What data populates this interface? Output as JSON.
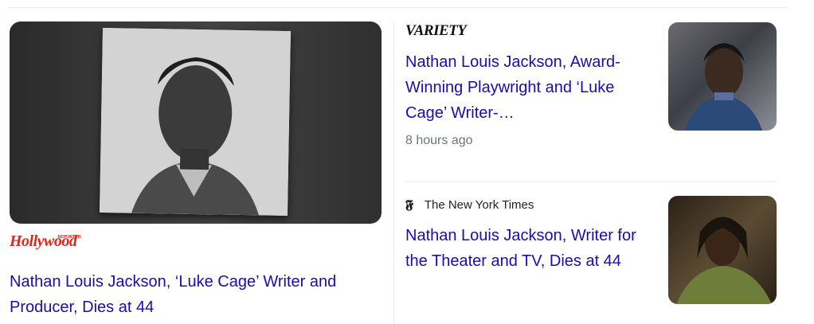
{
  "main_story": {
    "source": "Hollywood",
    "source_tag": "REPORTER",
    "title": "Nathan Louis Jackson, ‘Luke Cage’ Writer and Producer, Dies at 44"
  },
  "stories": [
    {
      "source": "VARIETY",
      "title": "Nathan Louis Jackson, Award-Winning Playwright and ‘Luke Cage’ Writer-…",
      "time": "8 hours ago"
    },
    {
      "source_icon": "𝕱",
      "source": "The New York Times",
      "title": "Nathan Louis Jackson, Writer for the Theater and TV, Dies at 44"
    }
  ],
  "colors": {
    "link": "#1a0dab",
    "thr_red": "#d82a1e",
    "meta": "#70757a"
  }
}
